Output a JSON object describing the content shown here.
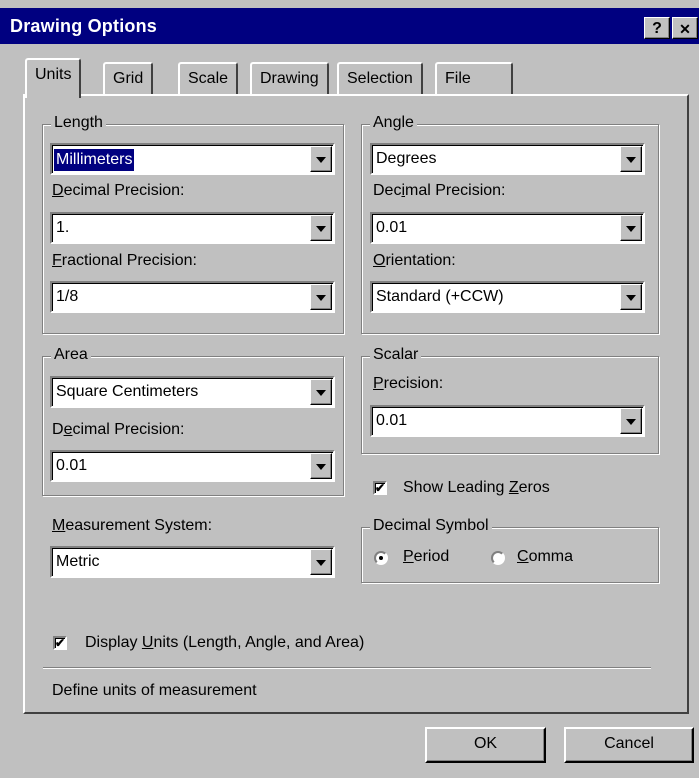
{
  "window": {
    "title": "Drawing Options",
    "help_label": "?",
    "close_label": "✕"
  },
  "tabs": [
    "Units",
    "Grid",
    "Scale",
    "Drawing",
    "Selection",
    "File"
  ],
  "length": {
    "group_label": "Length",
    "units_value": "Millimeters",
    "decimal_label": "Decimal Precision:",
    "decimal_value": "1.",
    "fractional_label": "Fractional Precision:",
    "fractional_value": "1/8"
  },
  "angle": {
    "group_label": "Angle",
    "units_value": "Degrees",
    "decimal_label": "Decimal Precision:",
    "decimal_value": "0.01",
    "orientation_label": "Orientation:",
    "orientation_value": "Standard (+CCW)"
  },
  "area": {
    "group_label": "Area",
    "units_value": "Square Centimeters",
    "decimal_label": "Decimal Precision:",
    "decimal_value": "0.01"
  },
  "scalar": {
    "group_label": "Scalar",
    "precision_label": "Precision:",
    "precision_value": "0.01"
  },
  "show_leading_zeros": {
    "label": "Show Leading Zeros",
    "checked": true
  },
  "measurement": {
    "label": "Measurement System:",
    "value": "Metric"
  },
  "decimal_symbol": {
    "group_label": "Decimal Symbol",
    "period_label": "Period",
    "comma_label": "Comma",
    "selected": "Period"
  },
  "display_units": {
    "label": "Display Units (Length, Angle, and Area)",
    "checked": true
  },
  "description": "Define units of measurement",
  "buttons": {
    "ok": "OK",
    "cancel": "Cancel"
  },
  "colors": {
    "titlebar": "#000080",
    "face": "#c0c0c0",
    "selection": "#000080"
  },
  "icons": {
    "check": "checkmark-icon",
    "dropdown": "triangle-down-icon"
  }
}
